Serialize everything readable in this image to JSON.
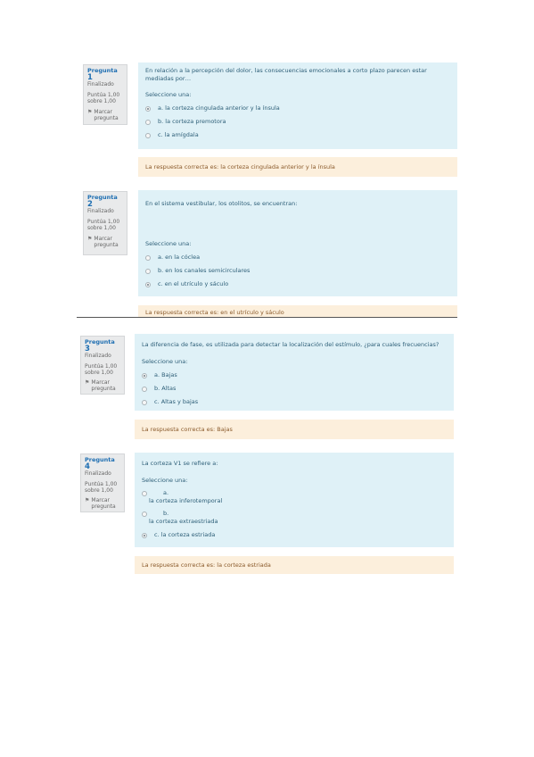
{
  "q1": {
    "num_prefix": "Pregunta",
    "num": "1",
    "state": "Finalizado",
    "marks": "Puntúa 1,00 sobre 1,00",
    "flag_label": "Marcar pregunta",
    "text": "En relación a la percepción del dolor, las consecuencias emocionales a corto plazo parecen estar mediadas por…",
    "prompt": "Seleccione una:",
    "options": [
      {
        "label": "a. la corteza cingulada anterior y la ínsula",
        "selected": true
      },
      {
        "label": "b. la corteza premotora",
        "selected": false
      },
      {
        "label": "c. la amígdala",
        "selected": false
      }
    ],
    "feedback": "La respuesta correcta es: la corteza cingulada anterior y la ínsula"
  },
  "q2": {
    "num_prefix": "Pregunta",
    "num": "2",
    "state": "Finalizado",
    "marks": "Puntúa 1,00 sobre 1,00",
    "flag_label": "Marcar pregunta",
    "text": "En el sistema vestibular, los otolitos, se encuentran:",
    "prompt": "Seleccione una:",
    "options": [
      {
        "label": "a. en la cóclea",
        "selected": false
      },
      {
        "label": "b. en los canales semicirculares",
        "selected": false
      },
      {
        "label": "c. en el utrículo y sáculo",
        "selected": true
      }
    ],
    "feedback": "La respuesta correcta es: en el utrículo y sáculo"
  },
  "q3": {
    "num_prefix": "Pregunta",
    "num": "3",
    "state": "Finalizado",
    "marks": "Puntúa 1,00 sobre 1,00",
    "flag_label": "Marcar pregunta",
    "text": "La diferencia de fase, es utilizada para detectar la localización del estímulo, ¿para cuales frecuencias?",
    "prompt": "Seleccione una:",
    "options": [
      {
        "label": "a. Bajas",
        "selected": true
      },
      {
        "label": "b. Altas",
        "selected": false
      },
      {
        "label": "c. Altas y bajas",
        "selected": false
      }
    ],
    "feedback": "La respuesta correcta es: Bajas"
  },
  "q4": {
    "num_prefix": "Pregunta",
    "num": "4",
    "state": "Finalizado",
    "marks": "Puntúa 1,00 sobre 1,00",
    "flag_label": "Marcar pregunta",
    "text": "La corteza V1 se refiere a:",
    "prompt": "Seleccione una:",
    "options": [
      {
        "letter": "a.",
        "label": "la corteza inferotemporal",
        "selected": false
      },
      {
        "letter": "b.",
        "label": "la corteza extraestriada",
        "selected": false
      },
      {
        "label": "c. la corteza estriada",
        "selected": true
      }
    ],
    "feedback": "La respuesta correcta es: la corteza estriada"
  }
}
